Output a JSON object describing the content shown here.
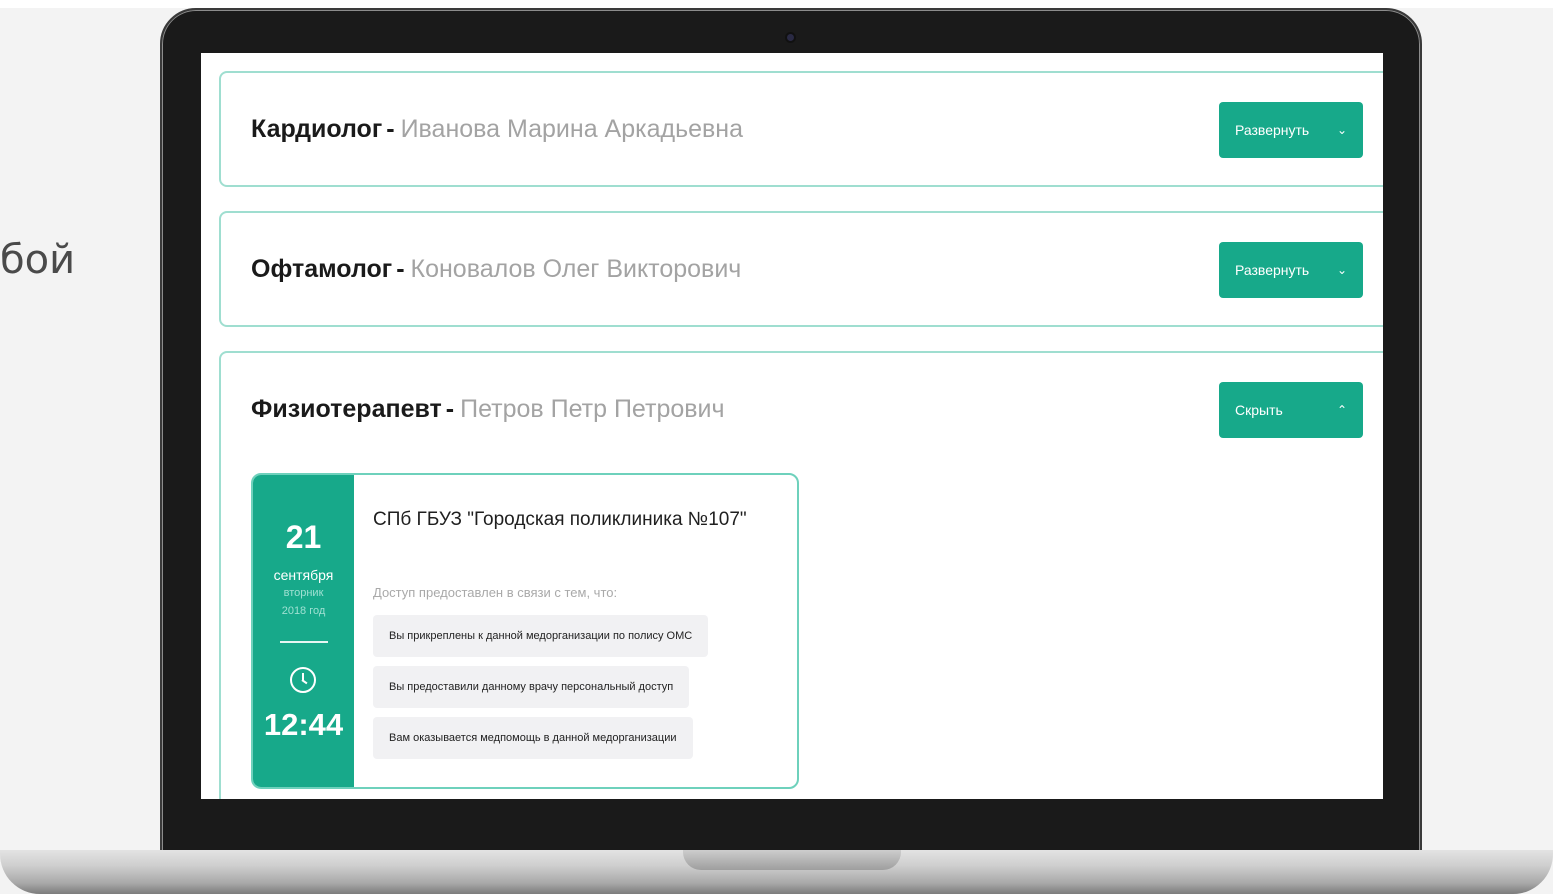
{
  "side_text": "бой",
  "cards": [
    {
      "specialty": "Кардиолог",
      "separator": "-",
      "doctor": "Иванова Марина Аркадьевна",
      "button_label": "Развернуть",
      "button_icon": "chevron-down-icon",
      "expanded": false
    },
    {
      "specialty": "Офтамолог",
      "separator": "-",
      "doctor": "Коновалов Олег Викторович",
      "button_label": "Развернуть",
      "button_icon": "chevron-down-icon",
      "expanded": false
    },
    {
      "specialty": "Физиотерапевт",
      "separator": "-",
      "doctor": "Петров Петр Петрович",
      "button_label": "Скрыть",
      "button_icon": "chevron-up-icon",
      "expanded": true
    }
  ],
  "appointment": {
    "day": "21",
    "month": "сентября",
    "weekday": "вторник",
    "year": "2018 год",
    "time": "12:44",
    "clinic": "СПб ГБУЗ \"Городская поликлиника №107\"",
    "access_label": "Доступ предоставлен в связи с тем, что:",
    "reasons": [
      "Вы прикреплены к данной медорганизации по полису ОМС",
      "Вы предоставили данному врачу персональный доступ",
      "Вам оказывается медпомощь в данной медорганизации"
    ]
  },
  "colors": {
    "accent": "#17a98a",
    "card_border": "#9fded0",
    "doctor_text": "#a3a3a3",
    "reason_bg": "#f1f1f3"
  }
}
